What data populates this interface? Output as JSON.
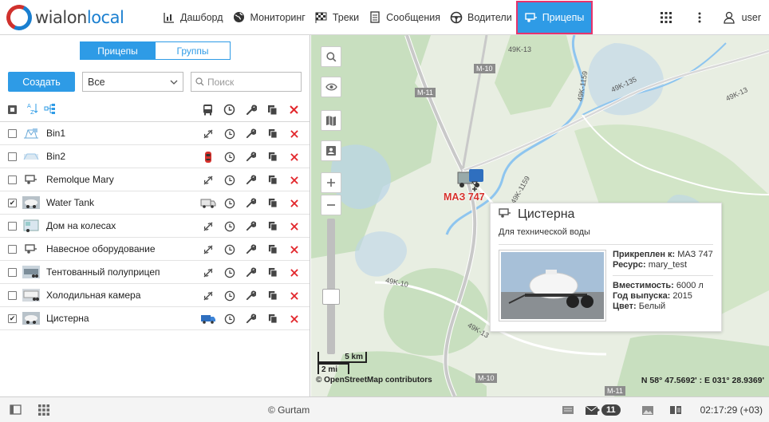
{
  "header": {
    "logo": {
      "wialon": "wialon",
      "local": "local"
    },
    "nav": [
      {
        "label": "Дашборд",
        "icon": "chart-icon"
      },
      {
        "label": "Мониторинг",
        "icon": "globe-icon"
      },
      {
        "label": "Треки",
        "icon": "flag-icon"
      },
      {
        "label": "Сообщения",
        "icon": "document-icon"
      },
      {
        "label": "Водители",
        "icon": "steering-wheel-icon"
      },
      {
        "label": "Прицепы",
        "icon": "trailer-icon",
        "active": true
      }
    ],
    "user": "user"
  },
  "panel": {
    "tabs": [
      {
        "label": "Прицепы",
        "active": true
      },
      {
        "label": "Группы",
        "active": false
      }
    ],
    "create_label": "Создать",
    "filter_value": "Все",
    "search_placeholder": "Поиск",
    "items": [
      {
        "name": "Bin1",
        "checked": false,
        "assigned_icon": "unlink-icon"
      },
      {
        "name": "Bin2",
        "checked": false,
        "assigned_icon": "red-car-icon"
      },
      {
        "name": "Remolque Mary",
        "checked": false,
        "assigned_icon": "unlink-icon"
      },
      {
        "name": "Water Tank",
        "checked": true,
        "assigned_icon": "white-truck-icon"
      },
      {
        "name": "Дом на колесах",
        "checked": false,
        "assigned_icon": "unlink-icon"
      },
      {
        "name": "Навесное оборудование",
        "checked": false,
        "assigned_icon": "unlink-icon"
      },
      {
        "name": "Тентованный полуприцеп",
        "checked": false,
        "assigned_icon": "unlink-icon"
      },
      {
        "name": "Холодильная камера",
        "checked": false,
        "assigned_icon": "unlink-icon"
      },
      {
        "name": "Цистерна",
        "checked": true,
        "assigned_icon": "blue-truck-icon"
      }
    ]
  },
  "map": {
    "road_labels": [
      "49K-13",
      "M-10",
      "M-11",
      "49K-1159",
      "49K-135",
      "49K-13",
      "49K-1159",
      "49K-10",
      "49K-13",
      "M-10",
      "M-11"
    ],
    "unit_label": "МАЗ 747",
    "scale_km": "5 km",
    "scale_mi": "2 mi",
    "attribution": "© OpenStreetMap contributors",
    "coordinates": "N 58° 47.5692' : E 031° 28.9369'",
    "popup": {
      "title": "Цистерна",
      "description": "Для технической воды",
      "attached_label": "Прикреплен к:",
      "attached_value": "МАЗ 747",
      "resource_label": "Ресурс:",
      "resource_value": "mary_test",
      "capacity_label": "Вместимость:",
      "capacity_value": "6000 л",
      "year_label": "Год выпуска:",
      "year_value": "2015",
      "color_label": "Цвет:",
      "color_value": "Белый"
    }
  },
  "footer": {
    "copyright": "© Gurtam",
    "notifications_count": "11",
    "time": "02:17:29 (+03)"
  }
}
